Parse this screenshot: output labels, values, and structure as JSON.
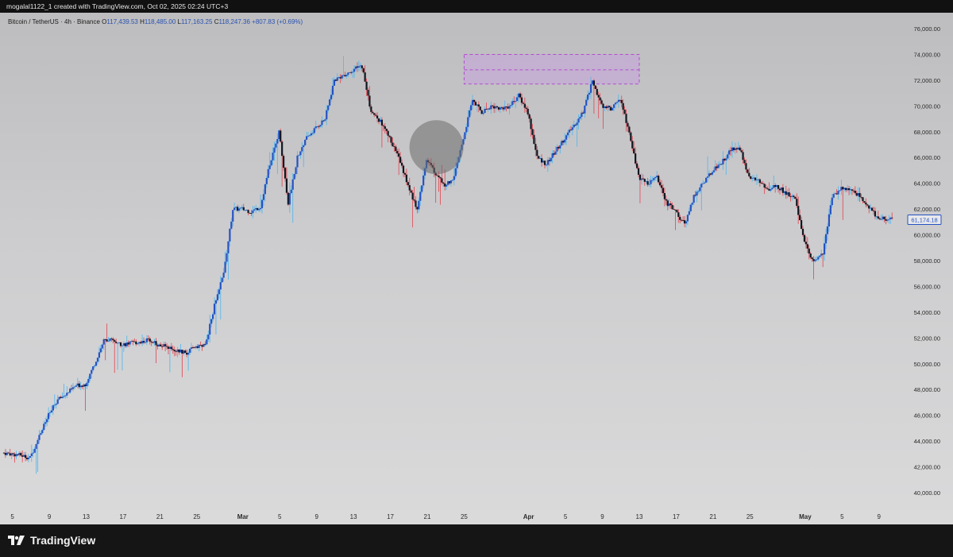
{
  "header": {
    "caption": "mogalal1122_1 created with TradingView.com, Oct 02, 2025 02:24 UTC+3"
  },
  "legend": {
    "symbol": "Bitcoin / TetherUS · 4h · Binance",
    "o_label": "O",
    "o_value": "117,439.53",
    "h_label": "H",
    "h_value": "118,485.00",
    "l_label": "L",
    "l_value": "117,163.25",
    "c_label": "C",
    "c_value": "118,247.36",
    "change": "+807.83 (+0.69%)"
  },
  "price_label": "61,174.18",
  "colors": {
    "up_body": "#2552c2",
    "down_body": "#11161f",
    "up_wick": "#5ab8ea",
    "down_wick": "#e0515c",
    "zone_fill": "#c79be0",
    "zone_border": "#b04fd0",
    "highlight_circle": "#6b6b6b",
    "price_tag_border": "#2552c2"
  },
  "brand": {
    "name": "TradingView",
    "icon": "tradingview-logo-icon"
  },
  "chart_data": {
    "type": "candlestick",
    "ylim": [
      39000,
      77000
    ],
    "yticks": [
      40000,
      42000,
      44000,
      46000,
      48000,
      50000,
      52000,
      54000,
      56000,
      58000,
      60000,
      62000,
      64000,
      66000,
      68000,
      70000,
      72000,
      74000,
      76000
    ],
    "ytick_labels": [
      "40,000.00",
      "42,000.00",
      "44,000.00",
      "46,000.00",
      "48,000.00",
      "50,000.00",
      "52,000.00",
      "54,000.00",
      "56,000.00",
      "58,000.00",
      "60,000.00",
      "62,000.00",
      "64,000.00",
      "66,000.00",
      "68,000.00",
      "70,000.00",
      "72,000.00",
      "74,000.00",
      "76,000.00"
    ],
    "x_start": "2024-02-04",
    "x_end": "2024-05-11",
    "x_ticks": [
      {
        "date": "2024-02-05",
        "label": "5"
      },
      {
        "date": "2024-02-09",
        "label": "9"
      },
      {
        "date": "2024-02-13",
        "label": "13"
      },
      {
        "date": "2024-02-17",
        "label": "17"
      },
      {
        "date": "2024-02-21",
        "label": "21"
      },
      {
        "date": "2024-02-25",
        "label": "25"
      },
      {
        "date": "2024-03-01",
        "label": "Mar"
      },
      {
        "date": "2024-03-05",
        "label": "5"
      },
      {
        "date": "2024-03-09",
        "label": "9"
      },
      {
        "date": "2024-03-13",
        "label": "13"
      },
      {
        "date": "2024-03-17",
        "label": "17"
      },
      {
        "date": "2024-03-21",
        "label": "21"
      },
      {
        "date": "2024-03-25",
        "label": "25"
      },
      {
        "date": "2024-04-01",
        "label": "Apr"
      },
      {
        "date": "2024-04-05",
        "label": "5"
      },
      {
        "date": "2024-04-09",
        "label": "9"
      },
      {
        "date": "2024-04-13",
        "label": "13"
      },
      {
        "date": "2024-04-17",
        "label": "17"
      },
      {
        "date": "2024-04-21",
        "label": "21"
      },
      {
        "date": "2024-04-25",
        "label": "25"
      },
      {
        "date": "2024-05-01",
        "label": "May"
      },
      {
        "date": "2024-05-05",
        "label": "5"
      },
      {
        "date": "2024-05-09",
        "label": "9"
      }
    ],
    "price_path": [
      [
        "2024-02-04",
        43100
      ],
      [
        "2024-02-06",
        42900
      ],
      [
        "2024-02-07",
        42700
      ],
      [
        "2024-02-08",
        44400
      ],
      [
        "2024-02-09",
        46000
      ],
      [
        "2024-02-10",
        47200
      ],
      [
        "2024-02-11",
        47700
      ],
      [
        "2024-02-12",
        48300
      ],
      [
        "2024-02-13",
        48400
      ],
      [
        "2024-02-14",
        50000
      ],
      [
        "2024-02-15",
        51800
      ],
      [
        "2024-02-16",
        51800
      ],
      [
        "2024-02-17",
        51500
      ],
      [
        "2024-02-18",
        51600
      ],
      [
        "2024-02-19",
        51700
      ],
      [
        "2024-02-20",
        51900
      ],
      [
        "2024-02-21",
        51400
      ],
      [
        "2024-02-22",
        51300
      ],
      [
        "2024-02-23",
        51000
      ],
      [
        "2024-02-24",
        50800
      ],
      [
        "2024-02-25",
        51400
      ],
      [
        "2024-02-26",
        51400
      ],
      [
        "2024-02-27",
        54500
      ],
      [
        "2024-02-28",
        57000
      ],
      [
        "2024-02-29",
        62000
      ],
      [
        "2024-03-01",
        62000
      ],
      [
        "2024-03-02",
        61800
      ],
      [
        "2024-03-03",
        62200
      ],
      [
        "2024-03-04",
        65500
      ],
      [
        "2024-03-05",
        68000
      ],
      [
        "2024-03-06",
        62500
      ],
      [
        "2024-03-07",
        66000
      ],
      [
        "2024-03-08",
        67500
      ],
      [
        "2024-03-09",
        68300
      ],
      [
        "2024-03-10",
        69000
      ],
      [
        "2024-03-11",
        72000
      ],
      [
        "2024-03-12",
        72400
      ],
      [
        "2024-03-13",
        72800
      ],
      [
        "2024-03-14",
        73100
      ],
      [
        "2024-03-15",
        69500
      ],
      [
        "2024-03-16",
        68800
      ],
      [
        "2024-03-17",
        67500
      ],
      [
        "2024-03-18",
        66000
      ],
      [
        "2024-03-19",
        63800
      ],
      [
        "2024-03-20",
        62000
      ],
      [
        "2024-03-21",
        65800
      ],
      [
        "2024-03-22",
        64800
      ],
      [
        "2024-03-23",
        63800
      ],
      [
        "2024-03-24",
        64500
      ],
      [
        "2024-03-25",
        67500
      ],
      [
        "2024-03-26",
        70500
      ],
      [
        "2024-03-27",
        69500
      ],
      [
        "2024-03-28",
        70000
      ],
      [
        "2024-03-29",
        69800
      ],
      [
        "2024-03-30",
        70000
      ],
      [
        "2024-03-31",
        70800
      ],
      [
        "2024-04-01",
        69500
      ],
      [
        "2024-04-02",
        66000
      ],
      [
        "2024-04-03",
        65500
      ],
      [
        "2024-04-04",
        66500
      ],
      [
        "2024-04-05",
        67500
      ],
      [
        "2024-04-06",
        68500
      ],
      [
        "2024-04-07",
        69500
      ],
      [
        "2024-04-08",
        72000
      ],
      [
        "2024-04-09",
        70000
      ],
      [
        "2024-04-10",
        69800
      ],
      [
        "2024-04-11",
        70500
      ],
      [
        "2024-04-12",
        68000
      ],
      [
        "2024-04-13",
        64500
      ],
      [
        "2024-04-14",
        64000
      ],
      [
        "2024-04-15",
        64500
      ],
      [
        "2024-04-16",
        62500
      ],
      [
        "2024-04-17",
        61800
      ],
      [
        "2024-04-18",
        60800
      ],
      [
        "2024-04-19",
        63000
      ],
      [
        "2024-04-20",
        64000
      ],
      [
        "2024-04-21",
        65000
      ],
      [
        "2024-04-22",
        65600
      ],
      [
        "2024-04-23",
        66600
      ],
      [
        "2024-04-24",
        66700
      ],
      [
        "2024-04-25",
        64500
      ],
      [
        "2024-04-26",
        64200
      ],
      [
        "2024-04-27",
        63500
      ],
      [
        "2024-04-28",
        63800
      ],
      [
        "2024-04-29",
        63200
      ],
      [
        "2024-04-30",
        62800
      ],
      [
        "2024-05-01",
        59500
      ],
      [
        "2024-05-02",
        57800
      ],
      [
        "2024-05-03",
        58500
      ],
      [
        "2024-05-04",
        63000
      ],
      [
        "2024-05-05",
        63600
      ],
      [
        "2024-05-06",
        63600
      ],
      [
        "2024-05-07",
        63000
      ],
      [
        "2024-05-08",
        62200
      ],
      [
        "2024-05-09",
        61300
      ],
      [
        "2024-05-10",
        61174
      ]
    ],
    "resistance_zone": {
      "x_from": "2024-03-25",
      "x_to": "2024-04-13",
      "price_top": 74000,
      "price_mid": 72800,
      "price_bottom": 71700
    },
    "highlight": {
      "x": "2024-03-22",
      "price": 66800
    },
    "last_price": 61174.18
  }
}
